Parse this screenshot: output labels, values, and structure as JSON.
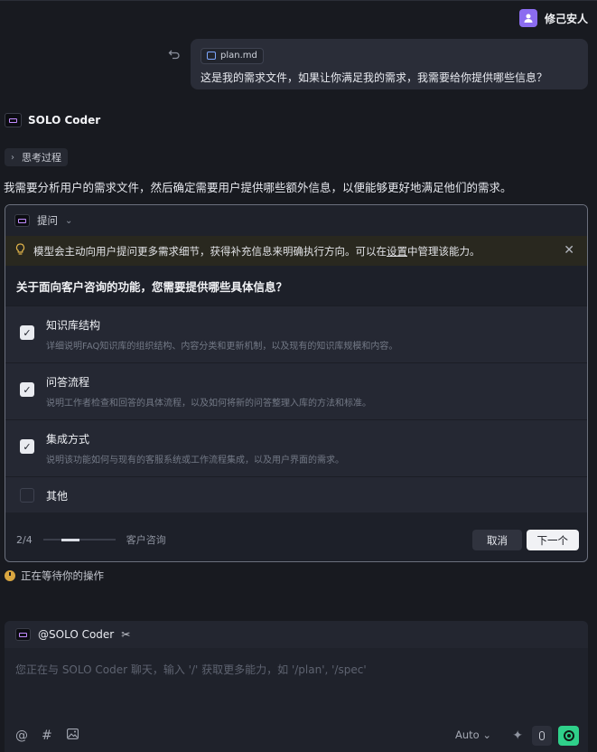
{
  "user": {
    "name": "修己安人",
    "avatar_icon": "user-avatar-icon"
  },
  "message": {
    "file": "plan.md",
    "text": "这是我的需求文件，如果让你满足我的需求，我需要给你提供哪些信息？"
  },
  "agent": {
    "name": "SOLO Coder",
    "thinking_label": "思考过程",
    "reply": "我需要分析用户的需求文件，然后确定需要用户提供哪些额外信息，以便能够更好地满足他们的需求。"
  },
  "question_card": {
    "title": "提问",
    "notice_pre": "模型会主动向用户提问更多需求细节，获得补充信息来明确执行方向。可以在",
    "notice_link": "设置",
    "notice_post": "中管理该能力。",
    "question": "关于面向客户咨询的功能，您需要提供哪些具体信息？",
    "options": [
      {
        "title": "知识库结构",
        "desc": "详细说明FAQ知识库的组织结构、内容分类和更新机制，以及现有的知识库规模和内容。",
        "checked": true
      },
      {
        "title": "问答流程",
        "desc": "说明工作者检查和回答的具体流程，以及如何将新的问答整理入库的方法和标准。",
        "checked": true
      },
      {
        "title": "集成方式",
        "desc": "说明该功能如何与现有的客服系统或工作流程集成，以及用户界面的需求。",
        "checked": true
      }
    ],
    "other_label": "其他",
    "pager": "2/4",
    "progress": 0.5,
    "question_name": "客户咨询",
    "cancel_label": "取消",
    "next_label": "下一个"
  },
  "status": {
    "waiting": "正在等待你的操作"
  },
  "composer": {
    "agent_tag": "@SOLO Coder",
    "placeholder": "您正在与 SOLO Coder 聊天，输入 '/' 获取更多能力，如 '/plan', '/spec'",
    "model": "Auto"
  },
  "colors": {
    "accent_green": "#2fd08a",
    "avatar_purple": "#8b6cf0",
    "warning_yellow": "#e2b54a"
  }
}
